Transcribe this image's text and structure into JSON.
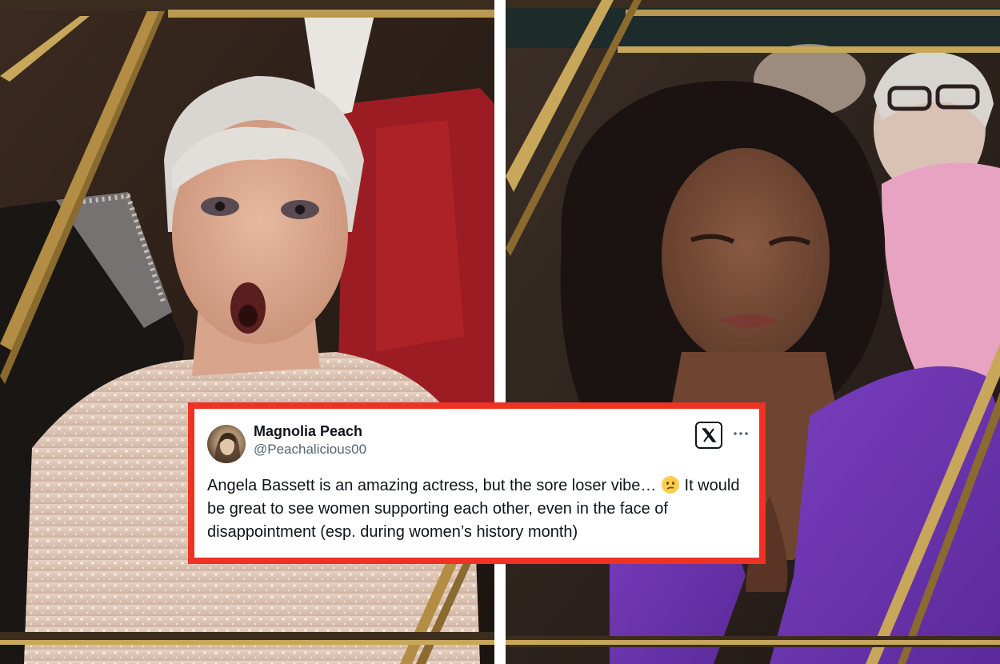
{
  "tweet": {
    "display_name": "Magnolia Peach",
    "handle": "@Peachalicious00",
    "text_before_emoji": "Angela Bassett is an amazing actress, but the sore loser vibe… ",
    "emoji_icon": "confused-face-emoji",
    "text_after_emoji": " It would be great to see women supporting each other, even in the face of disappointment (esp. during women’s history month)",
    "platform_icon": "x-logo-icon",
    "menu_icon": "more-options-icon"
  },
  "colors": {
    "frame_border": "#ee3224",
    "text_primary": "#0f1419",
    "text_secondary": "#536471",
    "gold_frame": "#c8a65a"
  }
}
